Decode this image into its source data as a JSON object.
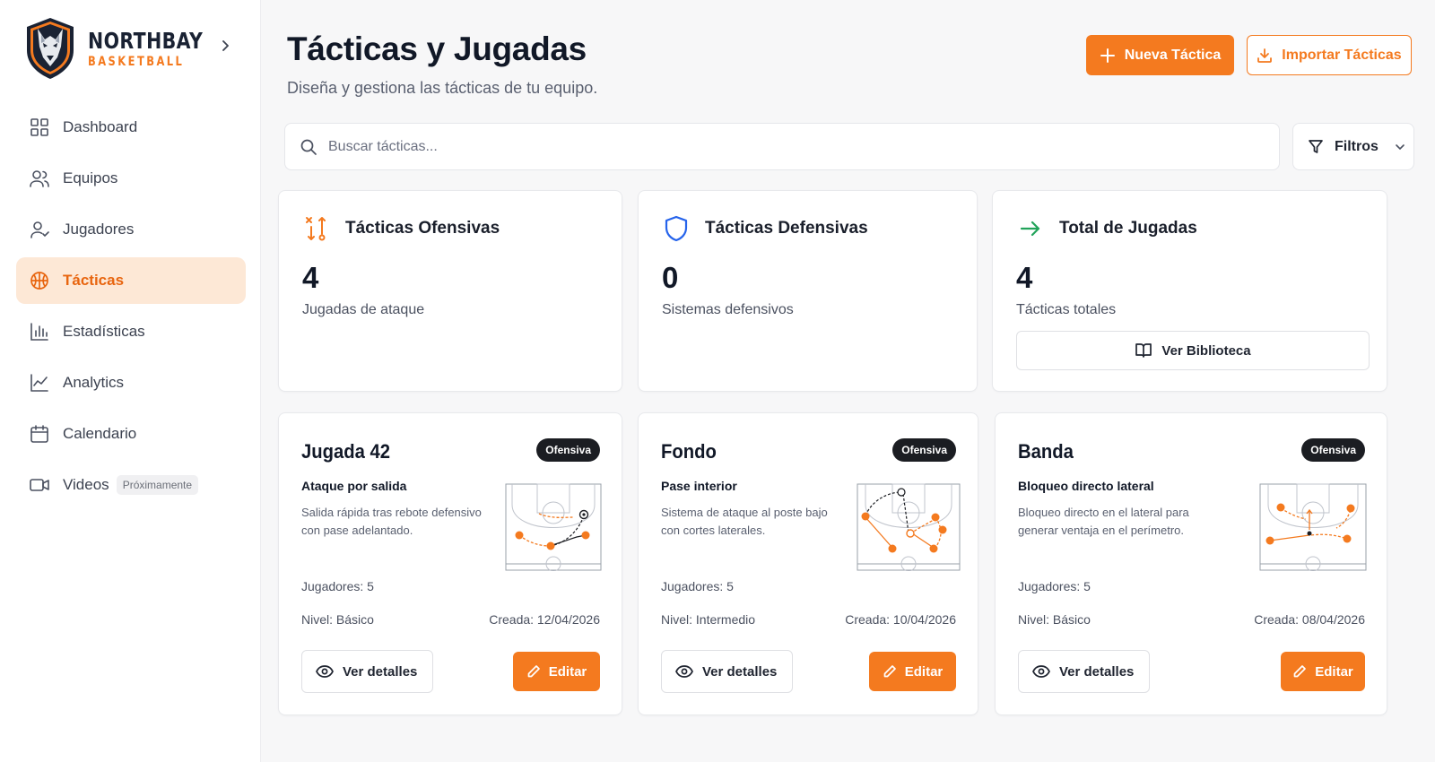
{
  "brand": {
    "name": "NORTHBAY",
    "sub": "BASKETBALL"
  },
  "sidebar": {
    "items": [
      {
        "label": "Dashboard",
        "icon": "dashboard-icon",
        "active": false
      },
      {
        "label": "Equipos",
        "icon": "users-icon",
        "active": false
      },
      {
        "label": "Jugadores",
        "icon": "user-icon",
        "active": false
      },
      {
        "label": "Tácticas",
        "icon": "basketball-icon",
        "active": true
      },
      {
        "label": "Estadísticas",
        "icon": "bar-chart-icon",
        "active": false
      },
      {
        "label": "Analytics",
        "icon": "line-chart-icon",
        "active": false
      },
      {
        "label": "Calendario",
        "icon": "calendar-icon",
        "active": false
      },
      {
        "label": "Videos",
        "icon": "video-icon",
        "active": false,
        "badge": "Próximamente"
      }
    ]
  },
  "header": {
    "title": "Tácticas y Jugadas",
    "subtitle": "Diseña y gestiona las tácticas de tu equipo.",
    "new_button": "Nueva Táctica",
    "import_button": "Importar Tácticas"
  },
  "search": {
    "placeholder": "Buscar tácticas...",
    "value": ""
  },
  "filters": {
    "label": "Filtros"
  },
  "stats": [
    {
      "title": "Tácticas Ofensivas",
      "value": "4",
      "label": "Jugadas de ataque",
      "icon": "offense-arrows-icon"
    },
    {
      "title": "Tácticas Defensivas",
      "value": "0",
      "label": "Sistemas defensivos",
      "icon": "shield-icon"
    },
    {
      "title": "Total de Jugadas",
      "value": "4",
      "label": "Tácticas totales",
      "icon": "arrow-right-icon",
      "button": "Ver Biblioteca"
    }
  ],
  "plays": [
    {
      "name": "Jugada 42",
      "badge": "Ofensiva",
      "subtitle": "Ataque por salida",
      "description": "Salida rápida tras rebote defensivo con pase adelantado.",
      "players": "Jugadores: 5",
      "level": "Nivel: Básico",
      "created": "Creada: 12/04/2026",
      "details_label": "Ver detalles",
      "edit_label": "Editar"
    },
    {
      "name": "Fondo",
      "badge": "Ofensiva",
      "subtitle": "Pase interior",
      "description": "Sistema de ataque al poste bajo con cortes laterales.",
      "players": "Jugadores: 5",
      "level": "Nivel: Intermedio",
      "created": "Creada:  10/04/2026",
      "details_label": "Ver detalles",
      "edit_label": "Editar"
    },
    {
      "name": "Banda",
      "badge": "Ofensiva",
      "subtitle": "Bloqueo directo lateral",
      "description": "Bloqueo directo en el lateral para generar ventaja en el perímetro.",
      "players": "Jugadores: 5",
      "level": "Nivel: Básico",
      "created": "Creada:  08/04/2026",
      "details_label": "Ver detalles",
      "edit_label": "Editar"
    }
  ],
  "colors": {
    "accent": "#f47a1f",
    "active_bg": "#fde8d6",
    "shield": "#2563eb",
    "green": "#22a35a"
  }
}
